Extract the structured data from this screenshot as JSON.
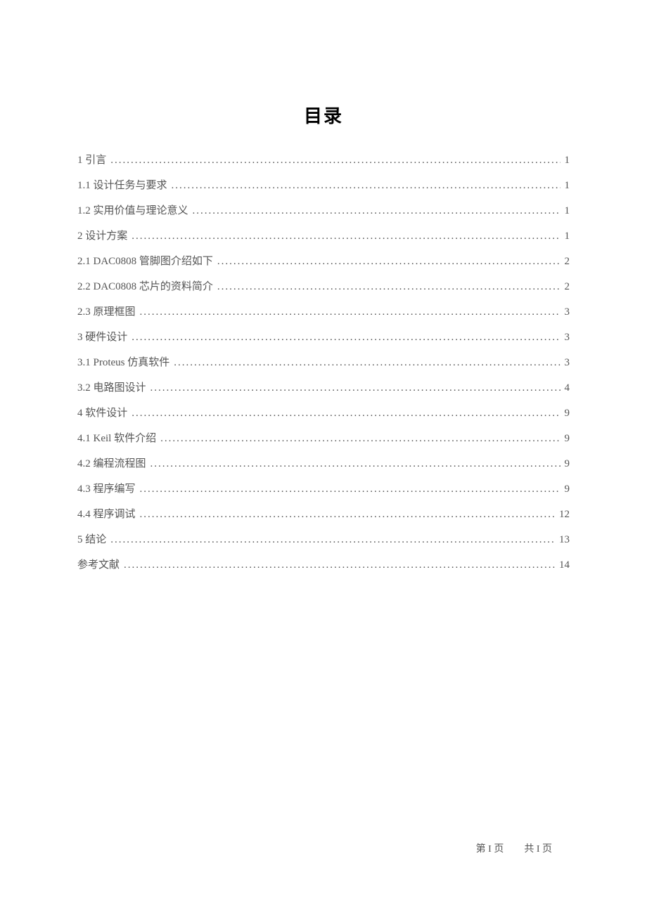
{
  "title": "目录",
  "toc": [
    {
      "label": "1 引言",
      "page": "1",
      "indent": 0
    },
    {
      "label": "1.1  设计任务与要求",
      "page": "1",
      "indent": 0
    },
    {
      "label": "1.2  实用价值与理论意义",
      "page": "1",
      "indent": 0
    },
    {
      "label": "2 设计方案",
      "page": "1",
      "indent": 0
    },
    {
      "label": "2.1  DAC0808 管脚图介绍如下",
      "page": "2",
      "indent": 0
    },
    {
      "label": "2.2  DAC0808 芯片的资料简介",
      "page": "2",
      "indent": 0
    },
    {
      "label": "2.3 原理框图",
      "page": "3",
      "indent": 0
    },
    {
      "label": "3 硬件设计",
      "page": "3",
      "indent": 0
    },
    {
      "label": "3.1  Proteus 仿真软件",
      "page": "3",
      "indent": 0
    },
    {
      "label": "3.2 电路图设计",
      "page": "4",
      "indent": 0
    },
    {
      "label": "4 软件设计",
      "page": "9",
      "indent": 0
    },
    {
      "label": "4.1 Keil 软件介绍",
      "page": "9",
      "indent": 0
    },
    {
      "label": "4.2 编程流程图",
      "page": "9",
      "indent": 0
    },
    {
      "label": "4.3 程序编写",
      "page": "9",
      "indent": 0
    },
    {
      "label": "4.4 程序调试",
      "page": "12",
      "indent": 0
    },
    {
      "label": "5 结论",
      "page": "13",
      "indent": 0
    },
    {
      "label": "参考文献",
      "page": "14",
      "indent": 0
    }
  ],
  "footer": {
    "left": "第 I 页",
    "right": "共 I 页"
  }
}
